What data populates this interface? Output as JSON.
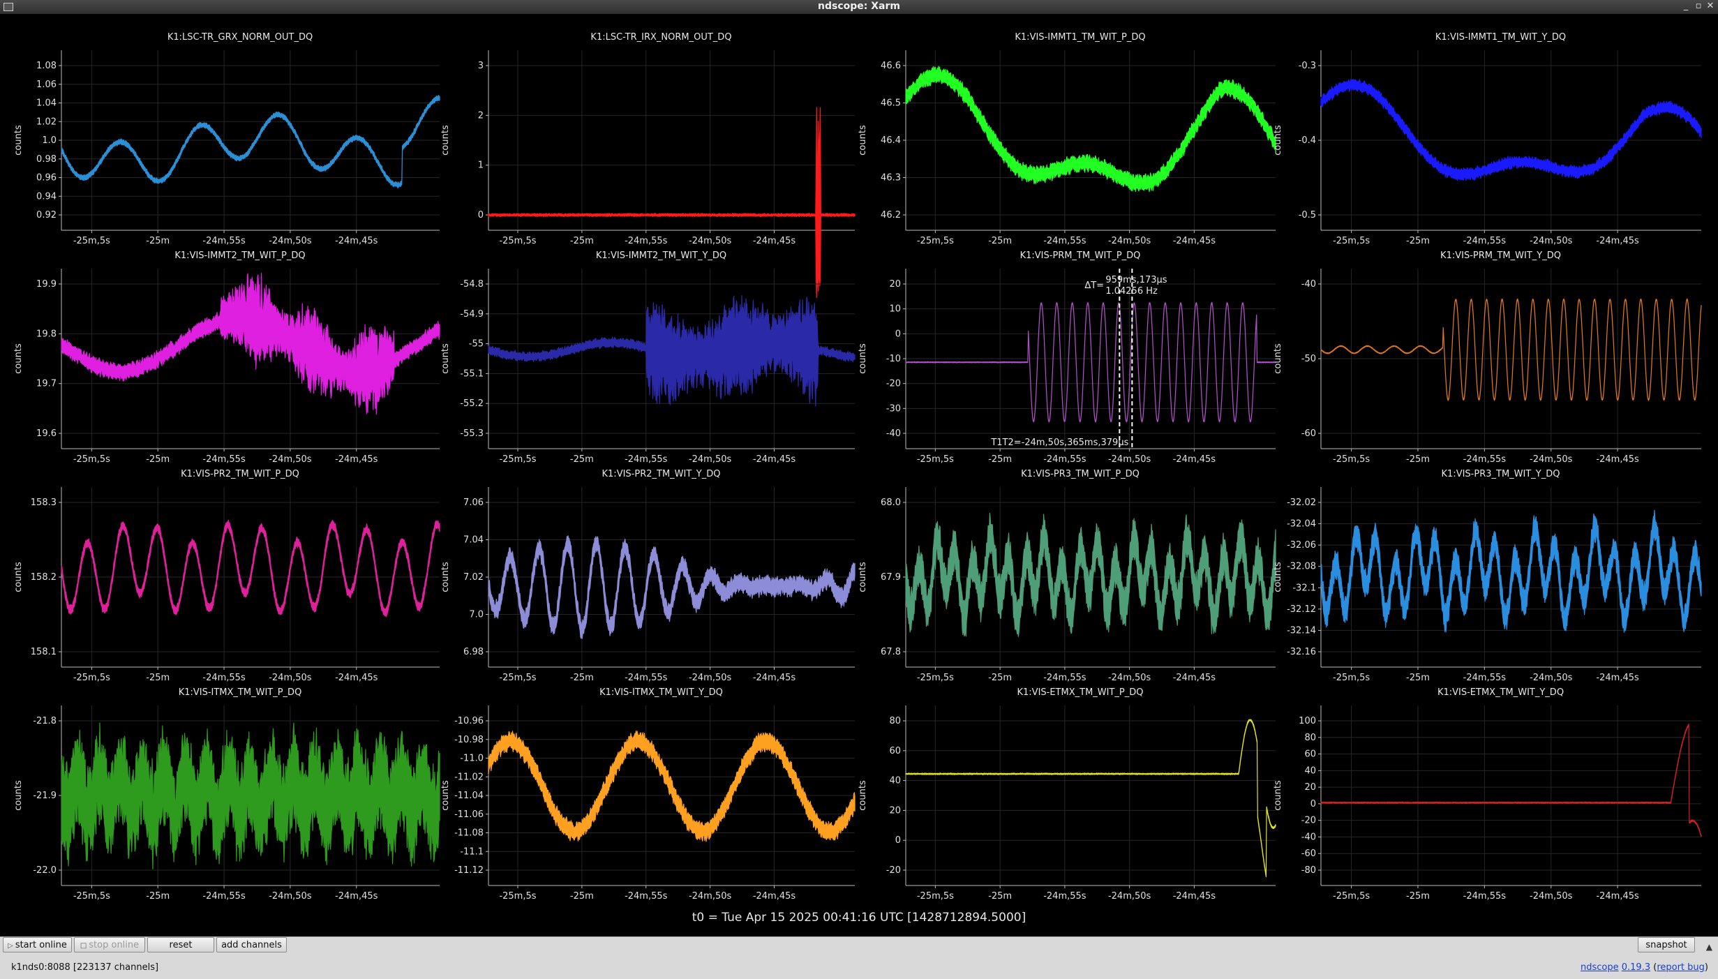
{
  "window": {
    "title": "ndscope: Xarm"
  },
  "x_ticks": [
    "-25m,5s",
    "-25m",
    "-24m,55s",
    "-24m,50s",
    "-24m,45s"
  ],
  "y_axis_label": "counts",
  "plots": [
    {
      "title": "K1:LSC-TR_GRX_NORM_OUT_DQ",
      "color": "#2b8fd6",
      "kind": "tr",
      "y_ticks": [
        "1.08",
        "1.06",
        "1.04",
        "1.02",
        "1.0",
        "0.98",
        "0.96",
        "0.94",
        "0.92"
      ]
    },
    {
      "title": "K1:LSC-TR_IRX_NORM_OUT_DQ",
      "color": "#ff1a1a",
      "kind": "spike",
      "y_ticks": [
        "3",
        "2",
        "1",
        "0"
      ]
    },
    {
      "title": "K1:VIS-IMMT1_TM_WIT_P_DQ",
      "color": "#22ff22",
      "kind": "wave_thick",
      "y_ticks": [
        "46.6",
        "46.5",
        "46.4",
        "46.3",
        "46.2"
      ]
    },
    {
      "title": "K1:VIS-IMMT1_TM_WIT_Y_DQ",
      "color": "#1a1aff",
      "kind": "wave_thick2",
      "y_ticks": [
        "-0.3",
        "-0.4",
        "-0.5"
      ]
    },
    {
      "title": "K1:VIS-IMMT2_TM_WIT_P_DQ",
      "color": "#e020e0",
      "kind": "burst",
      "y_ticks": [
        "19.9",
        "19.8",
        "19.7",
        "19.6"
      ]
    },
    {
      "title": "K1:VIS-IMMT2_TM_WIT_Y_DQ",
      "color": "#2a2aa8",
      "kind": "burst2",
      "y_ticks": [
        "-54.8",
        "-54.9",
        "-55",
        "-55.1",
        "-55.2",
        "-55.3"
      ]
    },
    {
      "title": "K1:VIS-PRM_TM_WIT_P_DQ",
      "color": "#b050c8",
      "kind": "osc",
      "y_ticks": [
        "20",
        "10",
        "0",
        "-10",
        "-20",
        "-30",
        "-40"
      ],
      "cursor": {
        "delta": "ΔT=",
        "dt": "959ms,173µs",
        "freq": "1.04256 Hz",
        "t1t2": "T1T2=-24m,50s,365ms,379µs"
      }
    },
    {
      "title": "K1:VIS-PRM_TM_WIT_Y_DQ",
      "color": "#e07818",
      "kind": "osc2",
      "y_ticks": [
        "-40",
        "-50",
        "-60"
      ]
    },
    {
      "title": "K1:VIS-PR2_TM_WIT_P_DQ",
      "color": "#e0209a",
      "kind": "pr2p",
      "y_ticks": [
        "158.3",
        "158.2",
        "158.1"
      ]
    },
    {
      "title": "K1:VIS-PR2_TM_WIT_Y_DQ",
      "color": "#8c8cd8",
      "kind": "pr2y",
      "y_ticks": [
        "7.06",
        "7.04",
        "7.02",
        "7.0",
        "6.98"
      ]
    },
    {
      "title": "K1:VIS-PR3_TM_WIT_P_DQ",
      "color": "#4e9e78",
      "kind": "noise",
      "y_ticks": [
        "68.0",
        "67.9",
        "67.8"
      ]
    },
    {
      "title": "K1:VIS-PR3_TM_WIT_Y_DQ",
      "color": "#2a8ee0",
      "kind": "noise_thin",
      "y_ticks": [
        "-32.02",
        "-32.04",
        "-32.06",
        "-32.08",
        "-32.1",
        "-32.12",
        "-32.14",
        "-32.16"
      ]
    },
    {
      "title": "K1:VIS-ITMX_TM_WIT_P_DQ",
      "color": "#2e9a1e",
      "kind": "noise_thick",
      "y_ticks": [
        "-21.8",
        "-21.9",
        "-22.0"
      ]
    },
    {
      "title": "K1:VIS-ITMX_TM_WIT_Y_DQ",
      "color": "#ffa020",
      "kind": "itmxy",
      "y_ticks": [
        "-10.96",
        "-10.98",
        "-11.0",
        "-11.02",
        "-11.04",
        "-11.06",
        "-11.08",
        "-11.1",
        "-11.12"
      ]
    },
    {
      "title": "K1:VIS-ETMX_TM_WIT_P_DQ",
      "color": "#e0e020",
      "kind": "etmxp",
      "y_ticks": [
        "80",
        "60",
        "40",
        "20",
        "0",
        "-20"
      ]
    },
    {
      "title": "K1:VIS-ETMX_TM_WIT_Y_DQ",
      "color": "#d02020",
      "kind": "etmxy",
      "y_ticks": [
        "100",
        "80",
        "60",
        "40",
        "20",
        "0",
        "-20",
        "-40",
        "-60",
        "-80"
      ]
    }
  ],
  "t0_label": "t0 = Tue Apr 15 2025 00:41:16 UTC [1428712894.5000]",
  "buttons": {
    "start_online": "start online",
    "stop_online": "stop online",
    "reset": "reset",
    "add_channels": "add channels",
    "snapshot": "snapshot"
  },
  "status": "k1nds0:8088  [223137 channels]",
  "version": {
    "name": "ndscope",
    "number": "0.19.3",
    "report": "report bug"
  },
  "icons": {
    "play": "play-icon",
    "stop": "stop-icon",
    "collapse": "triangle-up-icon",
    "window_menu": "window-menu-icon"
  }
}
